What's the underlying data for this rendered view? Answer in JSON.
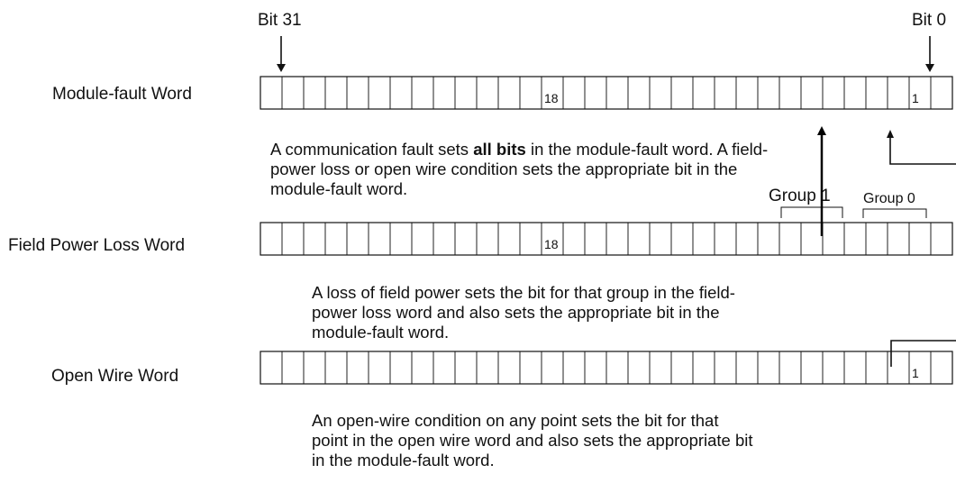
{
  "bit_labels": {
    "msb": "Bit 31",
    "lsb": "Bit 0"
  },
  "words": [
    {
      "label": "Module-fault Word",
      "marks": [
        {
          "bit": 18,
          "text": "18"
        },
        {
          "bit": 1,
          "text": "1"
        }
      ]
    },
    {
      "label": "Field Power Loss Word",
      "marks": [
        {
          "bit": 18,
          "text": "18"
        }
      ]
    },
    {
      "label": "Open Wire Word",
      "marks": [
        {
          "bit": 1,
          "text": "1"
        }
      ]
    }
  ],
  "groups": [
    {
      "text": "Group 1"
    },
    {
      "text": "Group 0"
    }
  ],
  "descriptions": {
    "module_fault": {
      "pre": "A communication fault sets ",
      "bold": "all bits",
      "post": " in the module-fault word. A field-power loss or open wire condition sets the appropriate bit in the module-fault word."
    },
    "field_power": "A loss of field power sets the bit for that group in the field-power loss word and also sets the appropriate bit in the module-fault word.",
    "open_wire": "An open-wire condition on any point sets the bit for that point in the open wire word and also sets the appropriate bit in the module-fault word."
  },
  "colors": {
    "line": "#111111",
    "background": "#ffffff"
  }
}
